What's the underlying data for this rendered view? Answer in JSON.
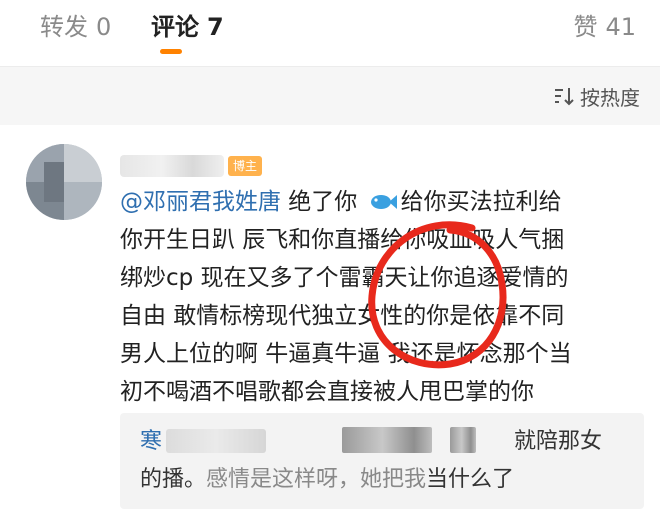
{
  "tabs": {
    "repost": {
      "label": "转发",
      "count": "0"
    },
    "comment": {
      "label": "评论",
      "count": "7"
    },
    "like": {
      "label": "赞",
      "count": "41"
    }
  },
  "sort": {
    "label": "按热度",
    "icon": "sort-icon"
  },
  "colors": {
    "accent": "#ff8200",
    "mention": "#2f6fb0",
    "badge": "#ffb24d",
    "annotation_circle": "#e8291c"
  },
  "comment": {
    "badge": "博主",
    "lines": [
      {
        "mention": "@邓丽君我姓唐",
        "text": " 绝了你 ",
        "icon": "fish-icon",
        "text_after": "给你买法拉利给"
      },
      {
        "text": "你开生日趴 辰飞和你直播给你吸血吸人气捆"
      },
      {
        "text": "绑炒cp 现在又多了个雷霸天让你追逐爱情的"
      },
      {
        "text": "自由 敢情标榜现代独立女性的你是依靠不同"
      },
      {
        "text": "男人上位的啊 牛逼真牛逼 我还是怀念那个当"
      },
      {
        "text": "初不喝酒不唱歌都会直接被人甩巴掌的你"
      }
    ]
  },
  "reply": {
    "name_start": "寒",
    "line1_tail": "就陪那女",
    "line2_start": "的播。",
    "line2_mid": "感情是这样呀，她把我",
    "line2_end": "当什么了"
  }
}
